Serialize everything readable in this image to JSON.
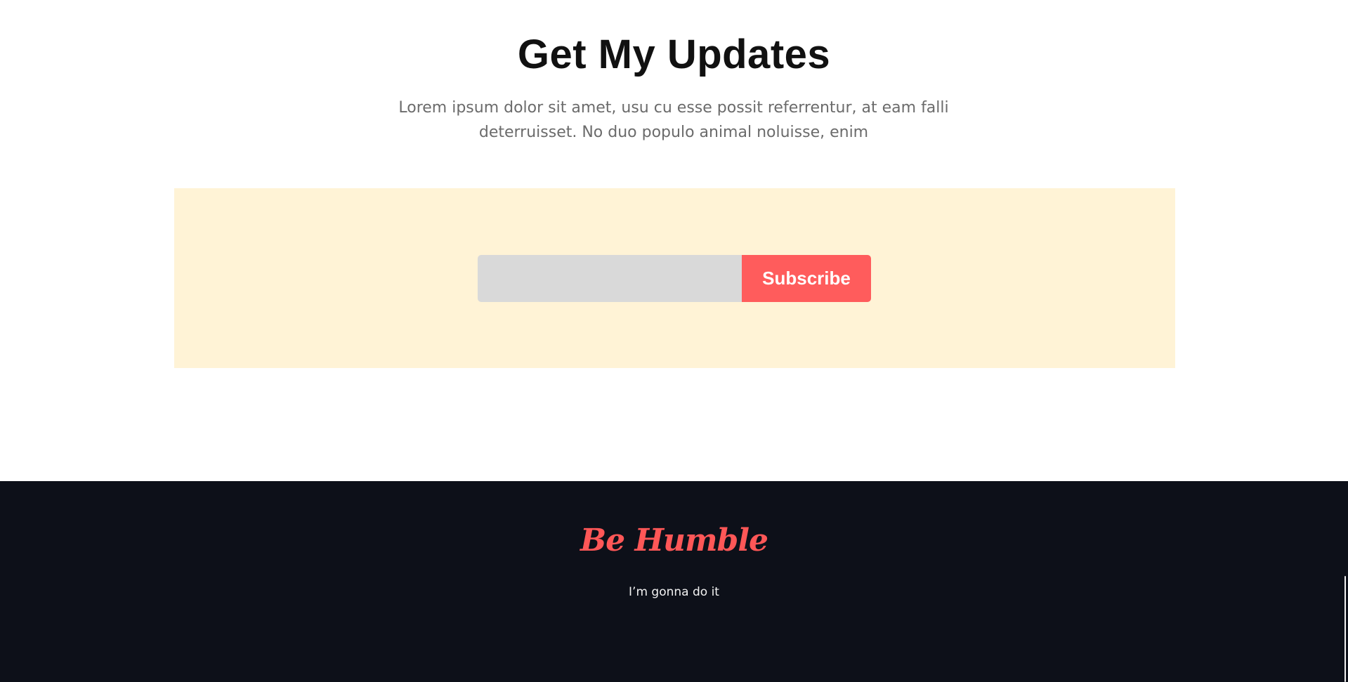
{
  "updates": {
    "title": "Get My Updates",
    "description": "Lorem ipsum dolor sit amet, usu cu esse possit referrentur, at eam falli deterruisset. No duo populo animal noluisse, enim"
  },
  "subscribe": {
    "email_value": "",
    "email_placeholder": "",
    "button_label": "Subscribe"
  },
  "footer": {
    "brand": "Be Humble",
    "tagline": "I’m gonna do it"
  },
  "colors": {
    "accent": "#ff5c5c",
    "panel_background": "#fff3d6",
    "footer_background": "#0d1019"
  }
}
